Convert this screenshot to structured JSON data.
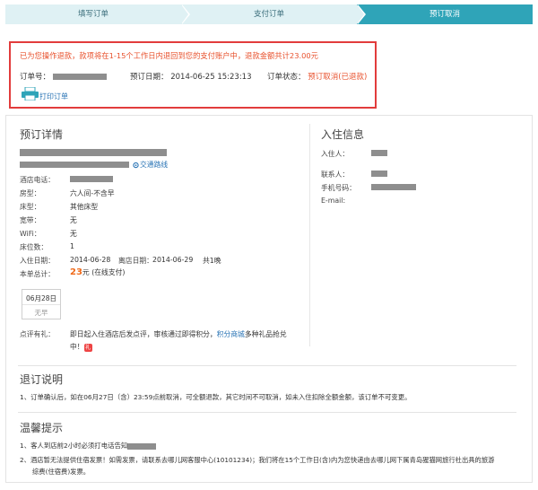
{
  "steps": [
    {
      "label": "填写订单"
    },
    {
      "label": "支付订单"
    },
    {
      "label": "预订取消"
    }
  ],
  "notice": {
    "message": "已为您操作退款，款项将在1-15个工作日内退回到您的支付账户中，退款金额共计23.00元",
    "order_no_label": "订单号：",
    "booking_date_label": "预订日期：",
    "booking_date_value": "2014-06-25 15:23:13",
    "order_status_label": "订单状态：",
    "order_status_value": "预订取消(已退款)",
    "print_label": "打印订单"
  },
  "details": {
    "title": "预订详情",
    "map_link": "交通路线",
    "rows": [
      {
        "label": "酒店电话：",
        "value": ""
      },
      {
        "label": "房型：",
        "value": "六人间-不含早"
      },
      {
        "label": "床型：",
        "value": "其他床型"
      },
      {
        "label": "宽带：",
        "value": "无"
      },
      {
        "label": "WiFi：",
        "value": "无"
      },
      {
        "label": "床位数：",
        "value": "1"
      }
    ],
    "checkin_label": "入住日期：",
    "checkin_value": "2014-06-28",
    "checkout_label": "离店日期：",
    "checkout_value": "2014-06-29",
    "nights": "共1晚",
    "total_label": "本单总计：",
    "total_price": "23",
    "total_suffix": "元 (在线支付)",
    "day_box_date": "06月28日",
    "day_box_breakfast": "无早",
    "review_label": "点评有礼：",
    "review_text_1": "即日起入住酒店后发点评，审核通过即得积分，",
    "review_link": "积分商城",
    "review_text_2": "多种礼品抢兑",
    "review_text_3": "中！"
  },
  "guest": {
    "title": "入住信息",
    "guest_label": "入住人：",
    "contact_label": "联系人：",
    "phone_label": "手机号码：",
    "email_label": "E-mail:"
  },
  "refund": {
    "title": "退订说明",
    "item1": "1、订单确认后，如在06月27日（含）23:59点前取消，可全额退款，其它时间不可取消，如未入住扣除全额金额，该订单不可变更。"
  },
  "tips": {
    "title": "温馨提示",
    "item1": "1、客人到店前2小时必须打电话告知",
    "item2_line1": "2、酒店暂无法提供住宿发票！如需发票，请联系去哪儿网客服中心(10101234)；我们将在15个工作日(含)内为您快递由去哪儿网下属青岛猩猫网旅行社出具的旅游",
    "item2_line2": "综费(住宿费)发票。"
  },
  "colors": {
    "accent": "#2fa4b8",
    "alert": "#e8522e",
    "link": "#2a74b5"
  }
}
